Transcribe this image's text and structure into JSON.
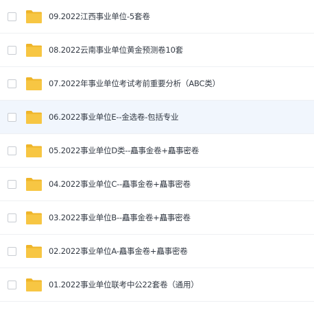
{
  "file_list": {
    "items": [
      {
        "name": "09.2022江西事业单位-5套卷",
        "icon": "folder-icon",
        "highlighted": false
      },
      {
        "name": "08.2022云南事业单位黄金预测卷10套",
        "icon": "folder-icon",
        "highlighted": false
      },
      {
        "name": "07.2022年事业单位考试考前重要分析（ABC类）",
        "icon": "folder-icon",
        "highlighted": false
      },
      {
        "name": "06.2022事业单位E--金选卷-包括专业",
        "icon": "folder-icon",
        "highlighted": true
      },
      {
        "name": "05.2022事业单位D类--矗事金卷+矗事密卷",
        "icon": "folder-icon",
        "highlighted": false
      },
      {
        "name": "04.2022事业单位C--矗事金卷+矗事密卷",
        "icon": "folder-icon",
        "highlighted": false
      },
      {
        "name": "03.2022事业单位B--矗事金卷+矗事密卷",
        "icon": "folder-icon",
        "highlighted": false
      },
      {
        "name": "02.2022事业单位A-矗事金卷+矗事密卷",
        "icon": "folder-icon",
        "highlighted": false
      },
      {
        "name": "01.2022事业单位联考中公22套卷（通用）",
        "icon": "folder-icon",
        "highlighted": false
      }
    ]
  },
  "colors": {
    "folder_body": "#f7c643",
    "folder_tab": "#efb52a",
    "row_highlight": "#f1f6fd",
    "divider": "#eef0f3",
    "text": "#333a44"
  }
}
